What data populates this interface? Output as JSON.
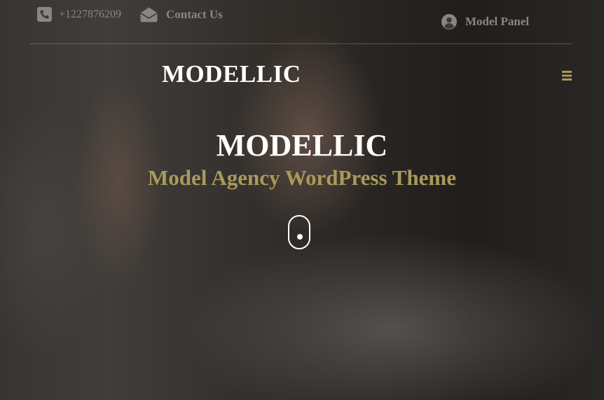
{
  "topbar": {
    "phone": {
      "icon": "phone-icon",
      "text": "+1227876209"
    },
    "contact": {
      "icon": "envelope-icon",
      "label": "Contact Us"
    },
    "model_panel": {
      "icon": "user-circle-icon",
      "label": "Model Panel"
    }
  },
  "header": {
    "logo": "MODELLIC",
    "menu_icon": "hamburger-menu-icon"
  },
  "hero": {
    "title": "MODELLIC",
    "subtitle": "Model Agency WordPress Theme",
    "scroll_icon": "mouse-scroll-icon"
  },
  "colors": {
    "accent": "#a89a5a",
    "text_light": "#ffffff",
    "text_muted": "#8a8681"
  }
}
